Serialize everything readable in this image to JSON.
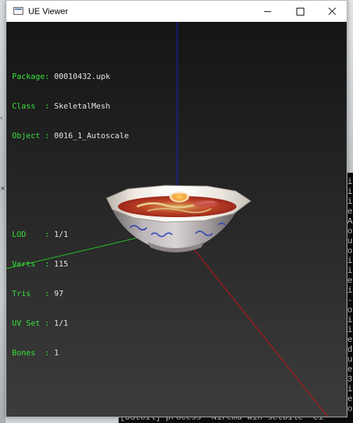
{
  "window": {
    "title": "UE Viewer",
    "icon": "app-window-icon",
    "controls": {
      "minimize": "minimize-icon",
      "maximize": "maximize-icon",
      "close": "close-icon"
    }
  },
  "info": {
    "object_block": [
      {
        "key": "Package",
        "sep": ":",
        "value": "00010432.upk"
      },
      {
        "key": "Class",
        "sep": ":",
        "value": "SkeletalMesh"
      },
      {
        "key": "Object",
        "sep": ":",
        "value": "0016_1_Autoscale"
      }
    ],
    "mesh_block": [
      {
        "key": "LOD",
        "sep": ":",
        "value": "1/1"
      },
      {
        "key": "Verts",
        "sep": ":",
        "value": "115"
      },
      {
        "key": "Tris",
        "sep": ":",
        "value": "97"
      },
      {
        "key": "UV Set",
        "sep": ":",
        "value": "1/1"
      },
      {
        "key": "Bones",
        "sep": ":",
        "value": "1"
      }
    ]
  },
  "scene": {
    "axis_colors": {
      "x": "#d01010",
      "y": "#20d020",
      "z": "#1a1ad8"
    },
    "label_color": "#39e13c",
    "value_color": "#e6e6e6"
  },
  "console": {
    "bottom_line": "[DStoIl] process 'Niremd win setbile' ci",
    "side_chars": [
      "i",
      "i",
      "i",
      "e",
      "A",
      "o",
      "u",
      "o",
      "i",
      "i",
      "e",
      "i",
      "-",
      "o",
      "i",
      "i",
      "e",
      "d",
      "u",
      "e",
      "3",
      "i",
      "e",
      "o",
      "i"
    ]
  }
}
